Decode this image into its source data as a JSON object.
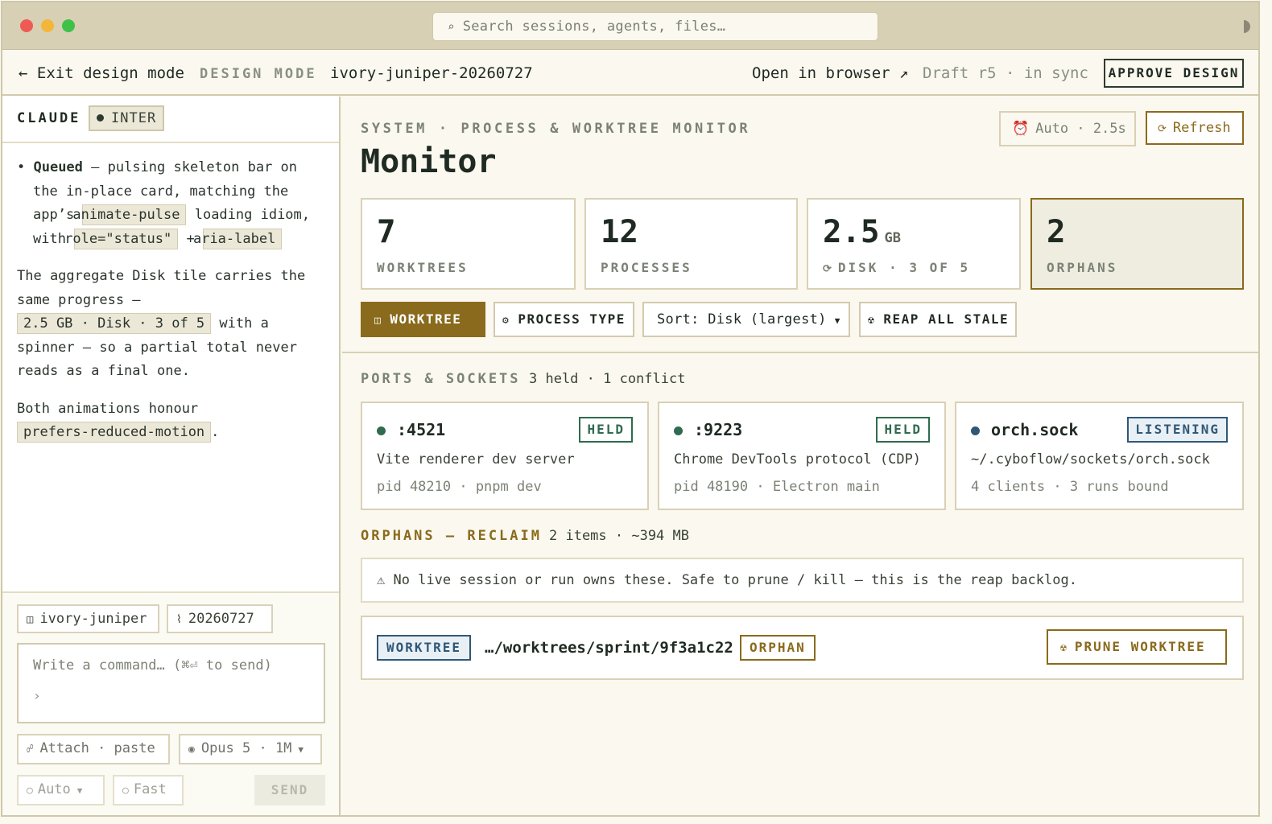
{
  "search": {
    "placeholder": "Search sessions, agents, files…"
  },
  "topbar": {
    "exit": "← Exit design mode",
    "mode": "DESIGN MODE",
    "session": "ivory-juniper-20260727",
    "open_browser": "Open in browser ↗",
    "draft": "Draft r5 · in sync",
    "approve": "APPROVE DESIGN"
  },
  "chat": {
    "agent": "CLAUDE",
    "font_badge": "INTER",
    "bullet_bold": "Queued",
    "bullet_text1": " — pulsing skeleton bar on the in-place card, matching the app’s ",
    "code1": "animate-pulse",
    "bullet_text2": " loading idiom, with ",
    "code2": "role=\"status\"",
    "bullet_text3": " + ",
    "code3": "aria-label",
    "p2_text1": "The aggregate Disk tile carries the same progress — ",
    "code4": "2.5 GB · Disk · 3 of 5",
    "p2_text2": " with a spinner — so a partial total never reads as a final one.",
    "p3_text1": "Both animations honour ",
    "code5": "prefers-reduced-motion",
    "p3_text2": "."
  },
  "composer": {
    "branch": "ivory-juniper",
    "date": "20260727",
    "placeholder": "Write a command… (⌘⏎ to send)",
    "prompt": "›",
    "attach": "Attach · paste",
    "model": "Opus 5 · 1M",
    "auto": "Auto",
    "fast": "Fast",
    "send": "SEND"
  },
  "monitor": {
    "breadcrumb": "SYSTEM · PROCESS & WORKTREE MONITOR",
    "title": "Monitor",
    "auto": "Auto · 2.5s",
    "refresh": "Refresh",
    "stats": [
      {
        "value": "7",
        "unit": "",
        "label": "WORKTREES"
      },
      {
        "value": "12",
        "unit": "",
        "label": "PROCESSES"
      },
      {
        "value": "2.5",
        "unit": "GB",
        "label": "DISK · 3 OF 5"
      },
      {
        "value": "2",
        "unit": "",
        "label": "ORPHANS"
      }
    ],
    "filters": {
      "worktree": "WORKTREE",
      "process_type": "PROCESS TYPE",
      "sort": "Sort: Disk (largest)",
      "reap": "REAP ALL STALE"
    },
    "ports_title": "PORTS & SOCKETS",
    "ports_meta": "3 held · 1 conflict",
    "ports": [
      {
        "name": ":4521",
        "badge": "HELD",
        "desc": "Vite renderer dev server",
        "meta": "pid 48210 · pnpm dev"
      },
      {
        "name": ":9223",
        "badge": "HELD",
        "desc": "Chrome DevTools protocol (CDP)",
        "meta": "pid 48190 · Electron main"
      },
      {
        "name": "orch.sock",
        "badge": "LISTENING",
        "desc": "~/.cyboflow/sockets/orch.sock",
        "meta": "4 clients · 3 runs bound"
      }
    ],
    "orphans_title": "ORPHANS — RECLAIM",
    "orphans_meta": "2 items · ~394 MB",
    "orphans_notice": "⚠ No live session or run owns these. Safe to prune / kill — this is the reap backlog.",
    "orphan_row": {
      "type": "WORKTREE",
      "path": "…/worktrees/sprint/9f3a1c22",
      "badge": "ORPHAN",
      "action": "PRUNE WORKTREE"
    }
  },
  "colors": {
    "accent": "#8a6a1c",
    "held": "#2f6b4f",
    "listening": "#2f5878",
    "bg": "#faf8ef"
  }
}
